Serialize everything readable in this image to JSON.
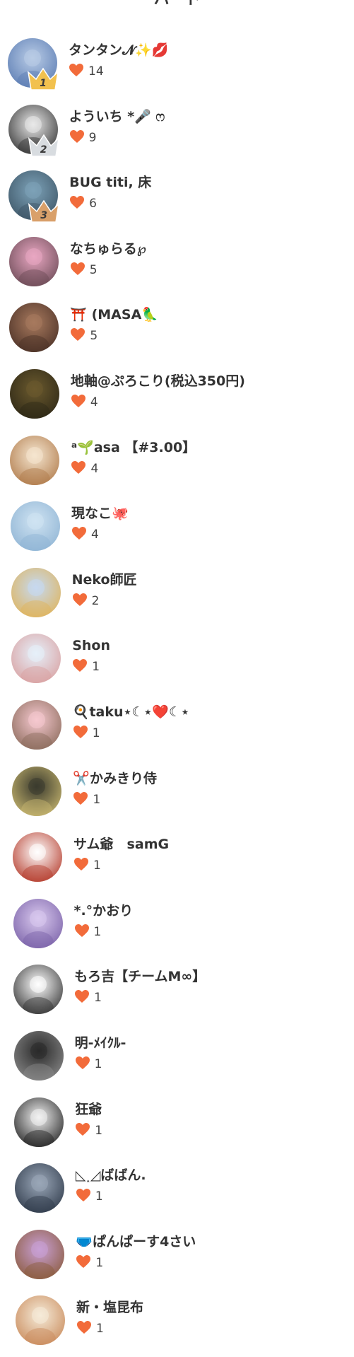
{
  "header": {
    "title": "ハート"
  },
  "colors": {
    "heart": "#F26B3A",
    "gold_crown": "#F2C14E",
    "silver_crown": "#D8DCE0",
    "bronze_crown": "#D9A06A"
  },
  "users": [
    {
      "rank": "1",
      "name": "タンタン𝓝✨💋",
      "likes": "14",
      "crown": "gold",
      "avatar_colors": [
        "#B9CCE6",
        "#5B7CB3"
      ]
    },
    {
      "rank": "2",
      "name": "よういち *🎤 ෆ",
      "likes": "9",
      "crown": "silver",
      "avatar_colors": [
        "#E9E9E9",
        "#333333"
      ]
    },
    {
      "rank": "3",
      "name": "BUG titi, 床",
      "likes": "6",
      "crown": "bronze",
      "avatar_colors": [
        "#7DA2B8",
        "#3D5566"
      ]
    },
    {
      "rank": "",
      "name": "なちゅらる℘",
      "likes": "5",
      "crown": "",
      "avatar_colors": [
        "#E9A7C2",
        "#6A4A55"
      ]
    },
    {
      "rank": "",
      "name": "⛩️ (MASA🦜",
      "likes": "5",
      "crown": "",
      "avatar_colors": [
        "#A87A5E",
        "#4A3026"
      ]
    },
    {
      "rank": "",
      "name": "地軸@ぷろこり(税込350円)",
      "likes": "4",
      "crown": "",
      "avatar_colors": [
        "#6B5A2E",
        "#2D2716"
      ]
    },
    {
      "rank": "",
      "name": "ᵃ🌱asa 【#3.00】",
      "likes": "4",
      "crown": "",
      "avatar_colors": [
        "#F5E6D0",
        "#B07A4A"
      ]
    },
    {
      "rank": "",
      "name": "現なこ🐙",
      "likes": "4",
      "crown": "",
      "avatar_colors": [
        "#CFE3F2",
        "#8FB4D4"
      ]
    },
    {
      "rank": "",
      "name": "Neko師匠",
      "likes": "2",
      "crown": "",
      "avatar_colors": [
        "#C6D9F0",
        "#E0B45A"
      ]
    },
    {
      "rank": "",
      "name": "Shon",
      "likes": "1",
      "crown": "",
      "avatar_colors": [
        "#E6F0FA",
        "#D9A0A0"
      ]
    },
    {
      "rank": "",
      "name": "🍳taku⋆☾⋆❤️☾⋆",
      "likes": "1",
      "crown": "",
      "avatar_colors": [
        "#F6C9D0",
        "#8A6A5A"
      ]
    },
    {
      "rank": "",
      "name": "✂️かみきり侍",
      "likes": "1",
      "crown": "",
      "avatar_colors": [
        "#3A3A2E",
        "#C9B870"
      ]
    },
    {
      "rank": "",
      "name": "サム爺　samG",
      "likes": "1",
      "crown": "",
      "avatar_colors": [
        "#FFFFFF",
        "#B43A2A"
      ]
    },
    {
      "rank": "",
      "name": "*.°かおり",
      "likes": "1",
      "crown": "",
      "avatar_colors": [
        "#D9C8EE",
        "#7A62A8"
      ]
    },
    {
      "rank": "",
      "name": "もろ吉【チームM∞】",
      "likes": "1",
      "crown": "",
      "avatar_colors": [
        "#FFFFFF",
        "#333333"
      ]
    },
    {
      "rank": "",
      "name": "明-ﾒｲｸﾙ-",
      "likes": "1",
      "crown": "",
      "avatar_colors": [
        "#2A2A2A",
        "#8A8A8A"
      ]
    },
    {
      "rank": "",
      "name": "狂爺",
      "likes": "1",
      "crown": "",
      "avatar_colors": [
        "#F2F2F2",
        "#222222"
      ]
    },
    {
      "rank": "",
      "name": "◺˰◿ばばん.",
      "likes": "1",
      "crown": "",
      "avatar_colors": [
        "#9AA7B8",
        "#2F3A4A"
      ]
    },
    {
      "rank": "",
      "name": "🩲ぱんぱーす4さい",
      "likes": "1",
      "crown": "",
      "avatar_colors": [
        "#C9A0D6",
        "#8A5A3A"
      ]
    },
    {
      "rank": "",
      "name": "新・塩昆布",
      "likes": "1",
      "crown": "",
      "avatar_colors": [
        "#F5EBD9",
        "#C98A5A"
      ]
    }
  ]
}
